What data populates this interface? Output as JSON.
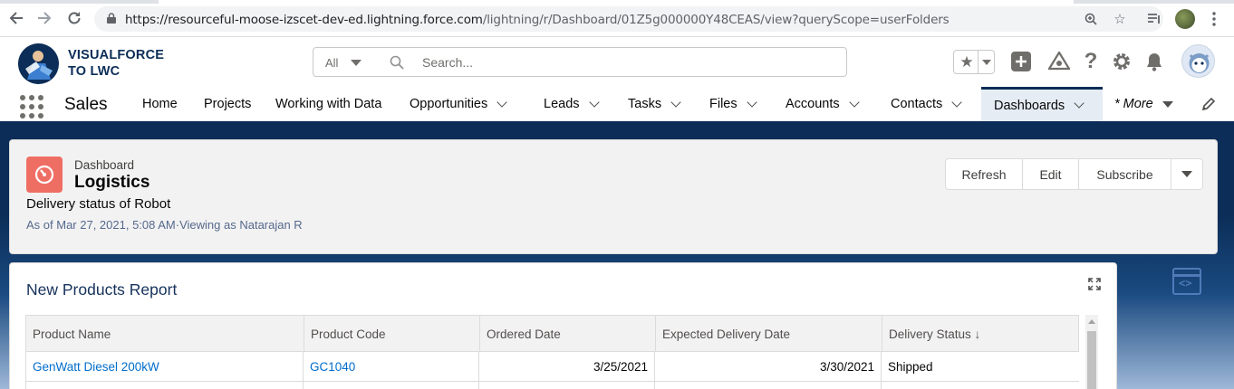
{
  "browser": {
    "url_host": "https://resourceful-moose-izscet-dev-ed.lightning.force.com",
    "url_path": "/lightning/r/Dashboard/01Z5g000000Y48CEAS/view?queryScope=userFolders",
    "back_icon": "arrow-left-icon",
    "forward_icon": "arrow-right-icon",
    "reload_icon": "reload-icon"
  },
  "header": {
    "logo_line1": "VISUALFORCE",
    "logo_line2": "TO LWC",
    "search_scope": "All",
    "search_placeholder": "Search..."
  },
  "nav": {
    "app_name": "Sales",
    "items": [
      {
        "label": "Home"
      },
      {
        "label": "Projects"
      },
      {
        "label": "Working with Data"
      },
      {
        "label": "Opportunities"
      },
      {
        "label": "Leads"
      },
      {
        "label": "Tasks"
      },
      {
        "label": "Files"
      },
      {
        "label": "Accounts"
      },
      {
        "label": "Contacts"
      },
      {
        "label": "Dashboards"
      }
    ],
    "more_label": "* More"
  },
  "dashboard": {
    "type_label": "Dashboard",
    "title": "Logistics",
    "description": "Delivery status of Robot",
    "meta": "As of Mar 27, 2021, 5:08 AM·Viewing as Natarajan R",
    "actions": {
      "refresh": "Refresh",
      "edit": "Edit",
      "subscribe": "Subscribe"
    }
  },
  "report": {
    "title": "New Products Report",
    "columns": [
      "Product Name",
      "Product Code",
      "Ordered Date",
      "Expected Delivery Date",
      "Delivery Status ↓"
    ],
    "rows": [
      {
        "product_name": "GenWatt Diesel 200kW",
        "product_code": "GC1040",
        "ordered_date": "3/25/2021",
        "expected_delivery_date": "3/30/2021",
        "delivery_status": "Shipped"
      }
    ]
  },
  "colors": {
    "brand_navy": "#0b2d57",
    "link_blue": "#006dcc",
    "dashboard_icon": "#ef6e64"
  }
}
